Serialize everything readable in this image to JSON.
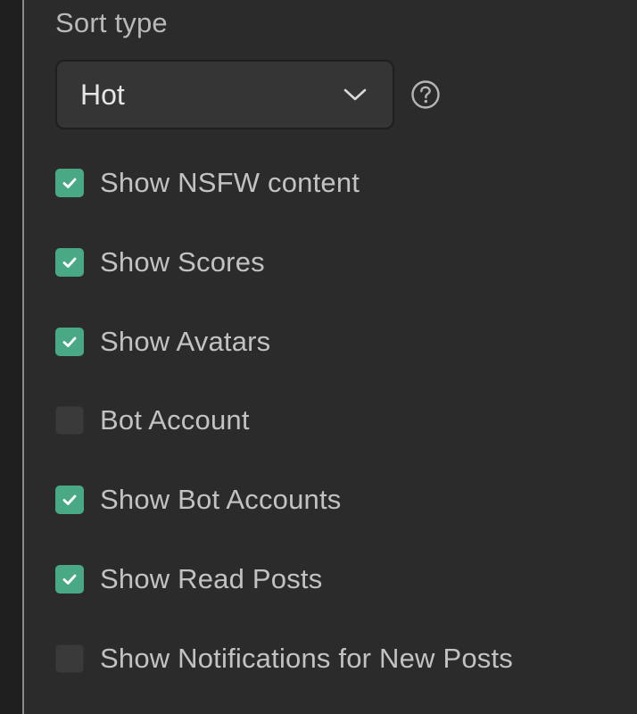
{
  "sort": {
    "label": "Sort type",
    "selected": "Hot"
  },
  "icons": {
    "chevron": "chevron-down-icon",
    "help": "help-circle-icon",
    "check": "check-icon"
  },
  "colors": {
    "accent": "#4aa985",
    "background": "#2b2b2b",
    "select_bg": "#353535",
    "text": "#c2c2c2"
  },
  "checkboxes": [
    {
      "label": "Show NSFW content",
      "checked": true
    },
    {
      "label": "Show Scores",
      "checked": true
    },
    {
      "label": "Show Avatars",
      "checked": true
    },
    {
      "label": "Bot Account",
      "checked": false
    },
    {
      "label": "Show Bot Accounts",
      "checked": true
    },
    {
      "label": "Show Read Posts",
      "checked": true
    },
    {
      "label": "Show Notifications for New Posts",
      "checked": false
    }
  ]
}
